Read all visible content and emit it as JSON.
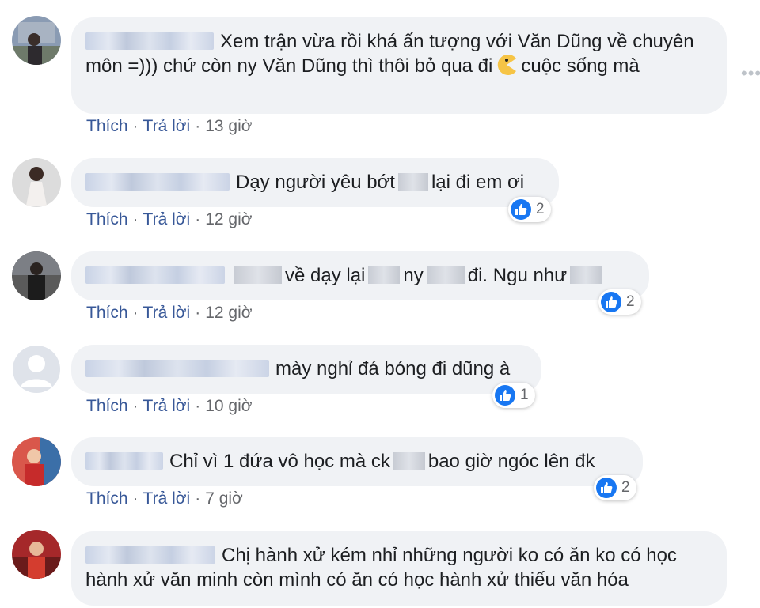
{
  "colors": {
    "bubble": "#f0f2f5",
    "action_link": "#385898",
    "meta": "#65676b",
    "like_blue": "#1877f2"
  },
  "action_labels": {
    "like": "Thích",
    "reply": "Trả lời",
    "separator": "·"
  },
  "comments": [
    {
      "text_before_emoji": "Xem trận vừa rồi khá ấn tượng với Văn Dũng về chuyên môn =))) chứ còn ny Văn Dũng thì thôi bỏ qua đi",
      "text_after_emoji": "cuộc sống mà",
      "emoji": "pacman-emoji",
      "time": "13 giờ",
      "likes": null
    },
    {
      "text_a": "Dạy người yêu bớt",
      "text_b": "lại đi em ơi",
      "time": "12 giờ",
      "likes": "2"
    },
    {
      "text_a": "về dạy lại",
      "text_b": "ny",
      "text_c": "đi. Ngu như",
      "time": "12 giờ",
      "likes": "2"
    },
    {
      "text_a": "mày nghỉ đá bóng đi dũng à",
      "time": "10 giờ",
      "likes": "1"
    },
    {
      "text_a": "Chỉ vì 1 đứa vô học mà ck",
      "text_b": "bao giờ ngóc lên đk",
      "time": "7 giờ",
      "likes": "2"
    },
    {
      "text_a": "Chị hành xử kém nhỉ những người ko có ăn ko có học hành xử văn minh còn mình có ăn có học hành xử thiếu văn hóa",
      "time": null,
      "likes": null
    }
  ]
}
